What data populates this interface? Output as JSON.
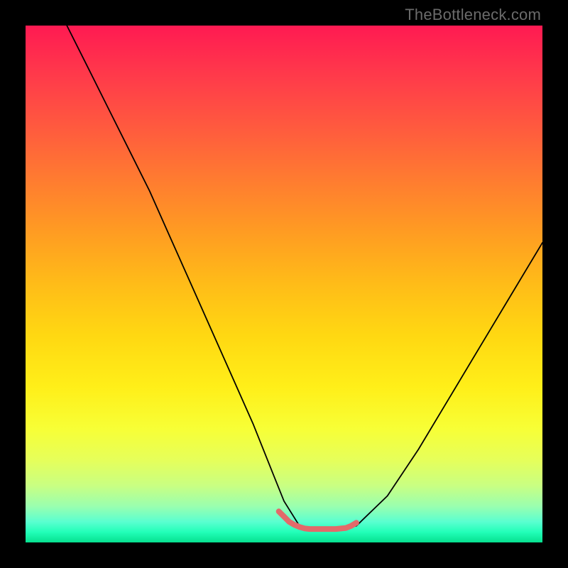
{
  "watermark": "TheBottleneck.com",
  "chart_data": {
    "type": "line",
    "title": "",
    "xlabel": "",
    "ylabel": "",
    "xlim": [
      0,
      100
    ],
    "ylim": [
      0,
      100
    ],
    "grid": false,
    "series": [
      {
        "name": "black-curve",
        "color": "#000000",
        "width": 1.8,
        "x": [
          8,
          12,
          16,
          20,
          24,
          28,
          32,
          36,
          40,
          44,
          48,
          50,
          53,
          56,
          60,
          64,
          70,
          76,
          82,
          88,
          94,
          100
        ],
        "y": [
          100,
          92,
          84,
          76,
          68,
          59,
          50,
          41,
          32,
          23,
          13,
          8,
          3.2,
          2.6,
          2.6,
          3.2,
          9,
          18,
          28,
          38,
          48,
          58
        ]
      },
      {
        "name": "red-valley-highlight",
        "color": "#e26a6a",
        "width": 8,
        "x": [
          49,
          50,
          51,
          52,
          53,
          54,
          55,
          56,
          58,
          60,
          62,
          63,
          64
        ],
        "y": [
          6.0,
          5.0,
          4.0,
          3.4,
          3.0,
          2.7,
          2.6,
          2.6,
          2.6,
          2.6,
          2.8,
          3.2,
          3.8
        ]
      }
    ]
  }
}
